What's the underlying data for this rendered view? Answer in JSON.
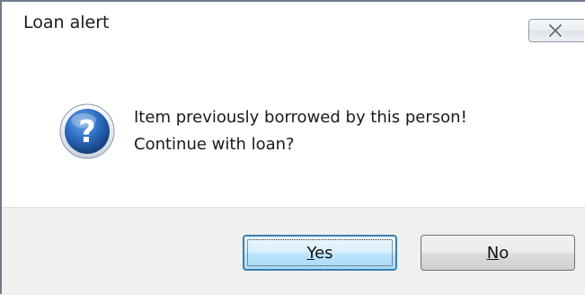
{
  "window": {
    "title": "Loan alert"
  },
  "message": {
    "line1": "Item previously borrowed by this person!",
    "line2": "Continue with loan?"
  },
  "icons": {
    "dialog_icon": "question-icon",
    "close": "close-icon"
  },
  "buttons": {
    "yes": {
      "accel": "Y",
      "rest": "es"
    },
    "no": {
      "accel": "N",
      "rest": "o"
    }
  },
  "colors": {
    "question_icon_blue": "#1f5fa8",
    "default_button_border": "#3c7fb1",
    "footer_bg": "#f0f0f0"
  }
}
